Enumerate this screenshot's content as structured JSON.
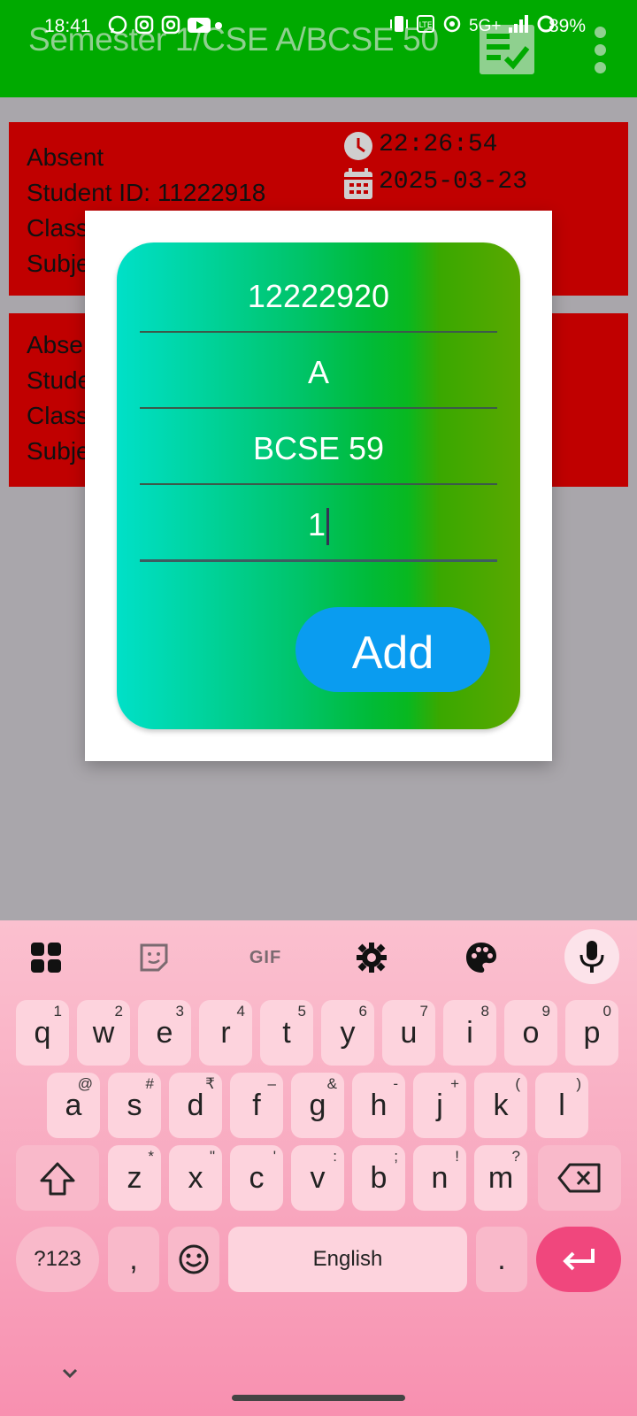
{
  "status_bar": {
    "time": "18:41",
    "network": "5G+",
    "battery": "89%"
  },
  "app_bar": {
    "title": "Semester 1/CSE A/BCSE 50",
    "action_icon": "checklist-icon",
    "menu_icon": "overflow-menu-icon"
  },
  "cards": [
    {
      "status": "Absent",
      "student_id": "Student ID: 11222918",
      "class_label": "Class",
      "subject_label": "Subje",
      "time": "22:26:54",
      "date": "2025-03-23"
    },
    {
      "status": "Abse",
      "student_id": "Stude",
      "class_label": "Class",
      "subject_label": "Subje"
    }
  ],
  "dialog": {
    "fields": [
      {
        "value": "12222920"
      },
      {
        "value": "A"
      },
      {
        "value": "BCSE 59"
      },
      {
        "value": "1"
      }
    ],
    "add_label": "Add"
  },
  "keyboard": {
    "toolbar": [
      "apps-icon",
      "sticker-icon",
      "GIF",
      "settings-icon",
      "palette-icon",
      "mic-icon"
    ],
    "gif_label": "GIF",
    "row1": [
      {
        "k": "q",
        "h": "1"
      },
      {
        "k": "w",
        "h": "2"
      },
      {
        "k": "e",
        "h": "3"
      },
      {
        "k": "r",
        "h": "4"
      },
      {
        "k": "t",
        "h": "5"
      },
      {
        "k": "y",
        "h": "6"
      },
      {
        "k": "u",
        "h": "7"
      },
      {
        "k": "i",
        "h": "8"
      },
      {
        "k": "o",
        "h": "9"
      },
      {
        "k": "p",
        "h": "0"
      }
    ],
    "row2": [
      {
        "k": "a",
        "h": "@"
      },
      {
        "k": "s",
        "h": "#"
      },
      {
        "k": "d",
        "h": "₹"
      },
      {
        "k": "f",
        "h": "–"
      },
      {
        "k": "g",
        "h": "&"
      },
      {
        "k": "h",
        "h": "-"
      },
      {
        "k": "j",
        "h": "+"
      },
      {
        "k": "k",
        "h": "("
      },
      {
        "k": "l",
        "h": ")"
      }
    ],
    "row3": [
      {
        "k": "z",
        "h": "*"
      },
      {
        "k": "x",
        "h": "\""
      },
      {
        "k": "c",
        "h": "'"
      },
      {
        "k": "v",
        "h": ":"
      },
      {
        "k": "b",
        "h": ";"
      },
      {
        "k": "n",
        "h": "!"
      },
      {
        "k": "m",
        "h": "?"
      }
    ],
    "symbols_label": "?123",
    "comma": ",",
    "space_label": "English",
    "period": "."
  }
}
